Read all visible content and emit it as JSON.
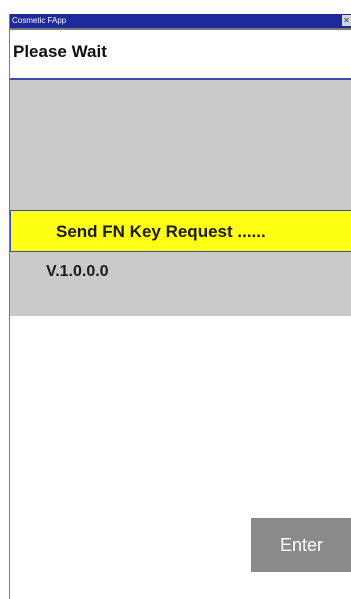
{
  "window": {
    "title": "Cosmetic FApp",
    "close_glyph": "✕"
  },
  "header": {
    "title": "Please Wait"
  },
  "status": {
    "message": "Send FN Key Request ......"
  },
  "version": {
    "text": "V.1.0.0.0"
  },
  "actions": {
    "enter_label": "Enter"
  },
  "colors": {
    "titlebar": "#1e2a9a",
    "status_highlight": "#ffff14",
    "panel_gray": "#cacaca",
    "button_gray": "#8a8a8a"
  }
}
